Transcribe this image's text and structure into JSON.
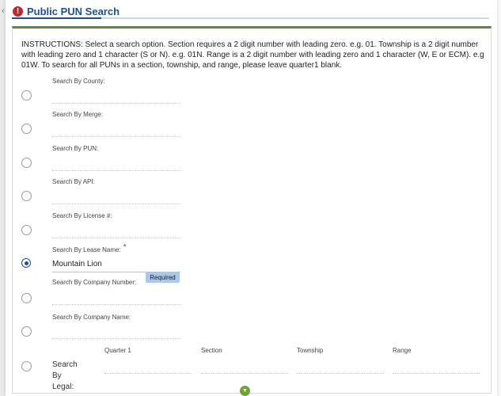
{
  "dialog": {
    "title": "Public PUN Search",
    "instructions": "INSTRUCTIONS: Select a search option. Section requires a 2 digit number with leading zero. e.g. 01. Township is a 2 digit number with leading zero and 1 character (S or N). e.g. 01N. Range is a 2 digit number with leading zero and 1 character (W, E or ECM). e.g 01W. To search for all PUNs in a section, township, and range, please leave quarter1 blank."
  },
  "options": [
    {
      "label": "Search By County:",
      "value": "",
      "selected": false
    },
    {
      "label": "Search By Merge:",
      "value": "",
      "selected": false
    },
    {
      "label": "Search By PUN:",
      "value": "",
      "selected": false
    },
    {
      "label": "Search By API:",
      "value": "",
      "selected": false
    },
    {
      "label": "Search By License #:",
      "value": "",
      "selected": false
    },
    {
      "label": "Search By Lease Name:",
      "value": "Mountain Lion",
      "selected": true,
      "required_mark": "*"
    },
    {
      "label": "Search By Company Number:",
      "value": "",
      "selected": false
    },
    {
      "label": "Search By Company Name:",
      "value": "",
      "selected": false
    }
  ],
  "tooltip": "Required",
  "legal": {
    "label": "Search By Legal:",
    "selected": false,
    "columns": [
      "Quarter 1",
      "Section",
      "Township",
      "Range"
    ]
  },
  "colors": {
    "title": "#1f4f8f",
    "accent_green": "#5a8a3a",
    "error_red": "#c0292c",
    "tooltip_bg": "#a8c8ee"
  },
  "icons": {
    "title_icon": "alert-icon",
    "expand_icon": "chevron-down-icon"
  }
}
